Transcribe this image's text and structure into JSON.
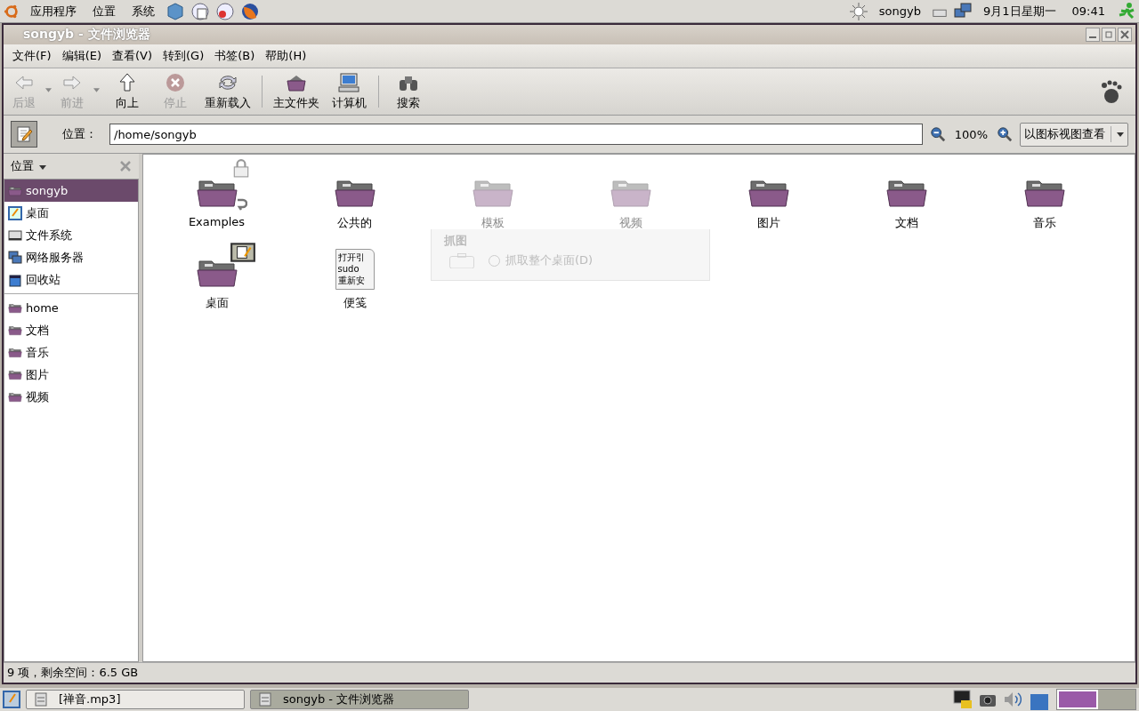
{
  "top_panel": {
    "menus": [
      "应用程序",
      "位置",
      "系统"
    ],
    "user": "songyb",
    "date": "9月1日星期一",
    "time": "09:41"
  },
  "window": {
    "title": "songyb - 文件浏览器"
  },
  "menubar": [
    "文件(F)",
    "编辑(E)",
    "查看(V)",
    "转到(G)",
    "书签(B)",
    "帮助(H)"
  ],
  "toolbar": [
    {
      "kind": "back",
      "label": "后退",
      "disabled": true,
      "dropdown": true
    },
    {
      "kind": "forward",
      "label": "前进",
      "disabled": true,
      "dropdown": true
    },
    {
      "kind": "up",
      "label": "向上",
      "disabled": false,
      "dropdown": false
    },
    {
      "kind": "stop",
      "label": "停止",
      "disabled": true,
      "dropdown": false
    },
    {
      "kind": "reload",
      "label": "重新载入",
      "disabled": false,
      "dropdown": false
    },
    {
      "kind": "separator"
    },
    {
      "kind": "home",
      "label": "主文件夹",
      "disabled": false,
      "dropdown": false
    },
    {
      "kind": "computer",
      "label": "计算机",
      "disabled": false,
      "dropdown": false
    },
    {
      "kind": "separator"
    },
    {
      "kind": "search",
      "label": "搜索",
      "disabled": false,
      "dropdown": false
    }
  ],
  "location": {
    "label": "位置：",
    "path": "/home/songyb",
    "zoom": "100%",
    "view": "以图标视图查看"
  },
  "sidebar": {
    "header": "位置",
    "places": [
      {
        "kind": "home",
        "label": "songyb",
        "selected": true
      },
      {
        "kind": "desktop",
        "label": "桌面",
        "selected": false
      },
      {
        "kind": "disk",
        "label": "文件系统",
        "selected": false
      },
      {
        "kind": "network",
        "label": "网络服务器",
        "selected": false
      },
      {
        "kind": "trash",
        "label": "回收站",
        "selected": false
      }
    ],
    "bookmarks": [
      {
        "label": "home",
        "selected": false
      },
      {
        "label": "文档",
        "selected": false
      },
      {
        "label": "音乐",
        "selected": false
      },
      {
        "label": "图片",
        "selected": false
      },
      {
        "label": "视频",
        "selected": false
      }
    ]
  },
  "files": [
    {
      "kind": "locked-link-folder",
      "name": "Examples",
      "faded": false
    },
    {
      "kind": "folder",
      "name": "公共的",
      "faded": false
    },
    {
      "kind": "folder",
      "name": "模板",
      "faded": true
    },
    {
      "kind": "folder",
      "name": "视频",
      "faded": true
    },
    {
      "kind": "folder",
      "name": "图片",
      "faded": false
    },
    {
      "kind": "folder",
      "name": "文档",
      "faded": false
    },
    {
      "kind": "folder",
      "name": "音乐",
      "faded": false
    },
    {
      "kind": "desktop-folder",
      "name": "桌面",
      "faded": false
    },
    {
      "kind": "text",
      "name": "便笺",
      "faded": false,
      "preview": [
        "打开引",
        "sudo",
        "重新安"
      ]
    }
  ],
  "ghost_dialog": {
    "section": "抓图",
    "option": "抓取整个桌面(D)"
  },
  "status": "9 项，剩余空间：6.5 GB",
  "taskbar": [
    {
      "label": "[禅音.mp3]",
      "selected": false
    },
    {
      "label": "songyb - 文件浏览器",
      "selected": true
    }
  ]
}
